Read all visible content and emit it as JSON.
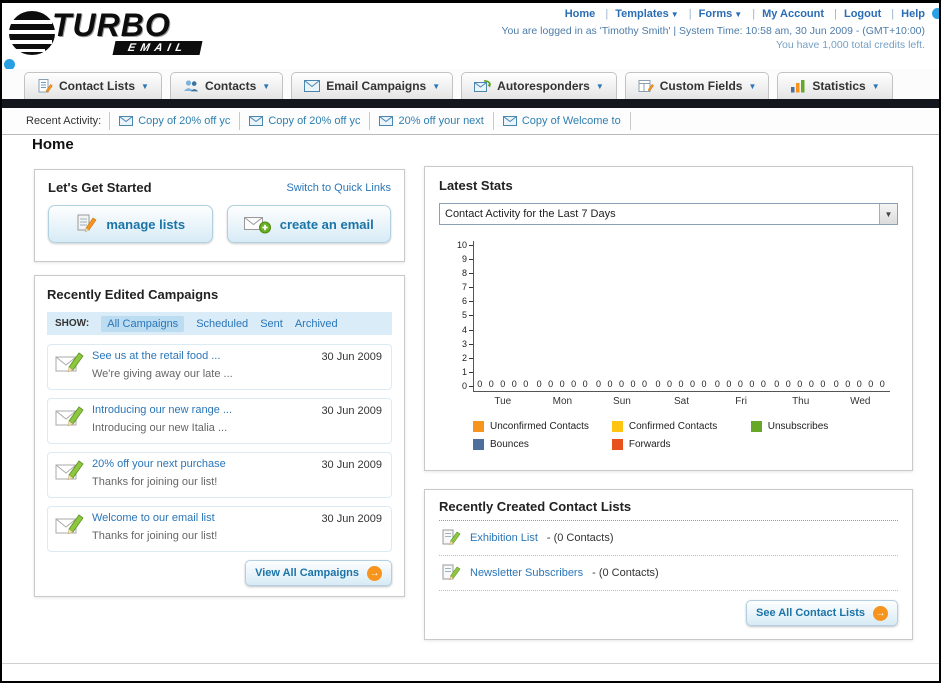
{
  "window": {
    "logo_primary": "TURBO",
    "logo_secondary": "EMAIL"
  },
  "header": {
    "links": [
      {
        "label": "Home",
        "caret": false
      },
      {
        "label": "Templates",
        "caret": true
      },
      {
        "label": "Forms",
        "caret": true
      },
      {
        "label": "My Account",
        "caret": false
      },
      {
        "label": "Logout",
        "caret": false
      },
      {
        "label": "Help",
        "caret": false
      }
    ],
    "session_line": "You are logged in as 'Timothy Smith' | System Time: 10:58 am, 30 Jun 2009 - (GMT+10:00)",
    "credits_line": "You have 1,000 total credits left."
  },
  "nav": {
    "tabs": [
      {
        "label": "Contact Lists"
      },
      {
        "label": "Contacts"
      },
      {
        "label": "Email Campaigns"
      },
      {
        "label": "Autoresponders"
      },
      {
        "label": "Custom Fields"
      },
      {
        "label": "Statistics"
      }
    ]
  },
  "recent_activity": {
    "label": "Recent Activity:",
    "items": [
      {
        "label": "Copy of 20% off yc"
      },
      {
        "label": "Copy of 20% off yc"
      },
      {
        "label": "20% off your next"
      },
      {
        "label": "Copy of Welcome to"
      }
    ]
  },
  "page": {
    "title": "Home"
  },
  "get_started": {
    "title": "Let's Get Started",
    "switch_link": "Switch to Quick Links",
    "manage_lists_label": "manage lists",
    "create_email_label": "create an email"
  },
  "campaigns": {
    "title": "Recently Edited Campaigns",
    "show_label": "SHOW:",
    "tabs": [
      "All Campaigns",
      "Scheduled",
      "Sent",
      "Archived"
    ],
    "items": [
      {
        "title": "See us at the retail food ...",
        "subtitle": "We're giving away our late ...",
        "date": "30 Jun 2009"
      },
      {
        "title": "Introducing our new range ...",
        "subtitle": "Introducing our new Italia ...",
        "date": "30 Jun 2009"
      },
      {
        "title": "20% off your next purchase",
        "subtitle": "Thanks for joining our list!",
        "date": "30 Jun 2009"
      },
      {
        "title": "Welcome to our email list",
        "subtitle": "Thanks for joining our list!",
        "date": "30 Jun 2009"
      }
    ],
    "view_all_label": "View All Campaigns",
    "arrow_glyph": "→"
  },
  "stats": {
    "title": "Latest Stats",
    "period_selected": "Contact Activity for the Last 7 Days",
    "chart_data": {
      "type": "bar",
      "title": "",
      "xlabel": "",
      "ylabel": "",
      "ylim": [
        0,
        10
      ],
      "grid": false,
      "legend_position": "bottom",
      "categories": [
        "Tue",
        "Mon",
        "Sun",
        "Sat",
        "Fri",
        "Thu",
        "Wed"
      ],
      "series": [
        {
          "name": "Unconfirmed Contacts",
          "color": "#f7941d",
          "values": [
            0,
            0,
            0,
            0,
            0,
            0,
            0
          ]
        },
        {
          "name": "Confirmed Contacts",
          "color": "#fdc411",
          "values": [
            0,
            0,
            0,
            0,
            0,
            0,
            0
          ]
        },
        {
          "name": "Unsubscribes",
          "color": "#67a829",
          "values": [
            0,
            0,
            0,
            0,
            0,
            0,
            0
          ]
        },
        {
          "name": "Bounces",
          "color": "#4e6e9d",
          "values": [
            0,
            0,
            0,
            0,
            0,
            0,
            0
          ]
        },
        {
          "name": "Forwards",
          "color": "#e8511d",
          "values": [
            0,
            0,
            0,
            0,
            0,
            0,
            0
          ]
        }
      ]
    }
  },
  "contact_lists": {
    "title": "Recently Created Contact Lists",
    "items": [
      {
        "name": "Exhibition List",
        "suffix": "- (0 Contacts)"
      },
      {
        "name": "Newsletter Subscribers",
        "suffix": "- (0 Contacts)"
      }
    ],
    "see_all_label": "See All Contact Lists",
    "arrow_glyph": "→"
  }
}
